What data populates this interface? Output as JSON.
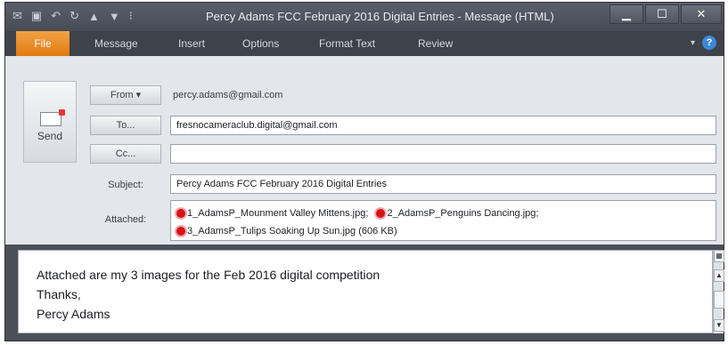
{
  "window": {
    "title": "Percy Adams FCC February 2016 Digital Entries  -  Message (HTML)"
  },
  "ribbon": {
    "tabs": [
      "File",
      "Message",
      "Insert",
      "Options",
      "Format Text",
      "Review"
    ],
    "help": "?"
  },
  "compose": {
    "send_label": "Send",
    "from_label": "From ▾",
    "from_value": "percy.adams@gmail.com",
    "to_label": "To...",
    "to_value": "fresnocameraclub.digital@gmail.com",
    "cc_label": "Cc...",
    "cc_value": "",
    "subject_label": "Subject:",
    "subject_value": "Percy Adams FCC February 2016 Digital Entries",
    "attached_label": "Attached:",
    "attachments": [
      "1_AdamsP_Mounment Valley Mittens.jpg;",
      "2_AdamsP_Penguins Dancing.jpg;",
      "3_AdamsP_Tulips Soaking Up Sun.jpg (606 KB)"
    ]
  },
  "body": {
    "lines": [
      "Attached are my 3 images for the Feb 2016 digital competition",
      "Thanks,",
      "Percy Adams"
    ]
  }
}
